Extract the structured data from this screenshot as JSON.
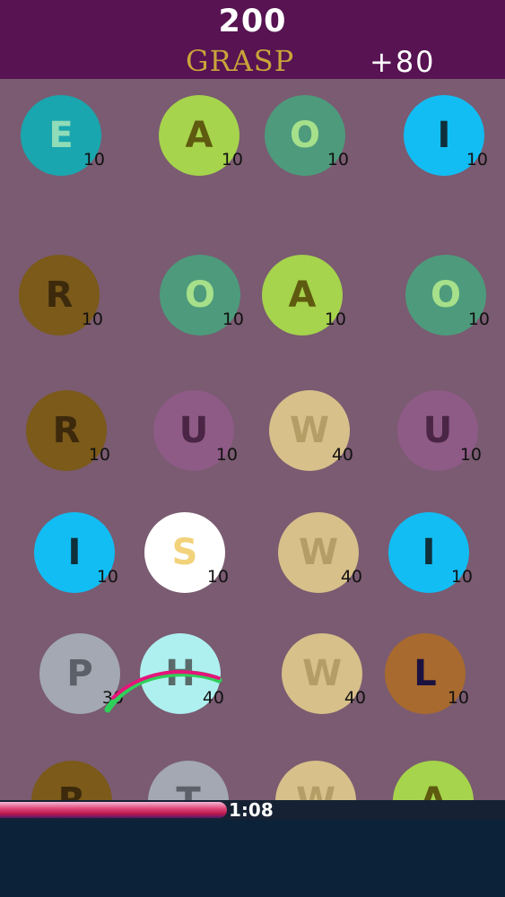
{
  "header": {
    "score": "200",
    "current_word": "GRASP",
    "word_bonus": "+80"
  },
  "board": {
    "tiles": [
      {
        "letter": "E",
        "points": "10",
        "color": "#1aa6ae",
        "text_color": "#8fdcb8"
      },
      {
        "letter": "A",
        "points": "10",
        "color": "#a6d44c",
        "text_color": "#5e5a10"
      },
      {
        "letter": "O",
        "points": "10",
        "color": "#4d9b7c",
        "text_color": "#a6e08a"
      },
      {
        "letter": "I",
        "points": "10",
        "color": "#12bdf3",
        "text_color": "#0f2f3a"
      },
      {
        "letter": "R",
        "points": "10",
        "color": "#7b5a1a",
        "text_color": "#3d2a0c"
      },
      {
        "letter": "O",
        "points": "10",
        "color": "#4d9b7c",
        "text_color": "#a6e08a"
      },
      {
        "letter": "A",
        "points": "10",
        "color": "#a6d44c",
        "text_color": "#5e5a10"
      },
      {
        "letter": "O",
        "points": "10",
        "color": "#4d9b7c",
        "text_color": "#a6e08a"
      },
      {
        "letter": "R",
        "points": "10",
        "color": "#7b5a1a",
        "text_color": "#3d2a0c"
      },
      {
        "letter": "U",
        "points": "10",
        "color": "#8e5a86",
        "text_color": "#4a2545"
      },
      {
        "letter": "W",
        "points": "40",
        "color": "#d7c08a",
        "text_color": "#b59e66"
      },
      {
        "letter": "U",
        "points": "10",
        "color": "#8e5a86",
        "text_color": "#4a2545"
      },
      {
        "letter": "I",
        "points": "10",
        "color": "#12bdf3",
        "text_color": "#0f2f3a"
      },
      {
        "letter": "S",
        "points": "10",
        "color": "#ffffff",
        "text_color": "#f2d27a"
      },
      {
        "letter": "W",
        "points": "40",
        "color": "#d7c08a",
        "text_color": "#b59e66"
      },
      {
        "letter": "I",
        "points": "10",
        "color": "#12bdf3",
        "text_color": "#0f2f3a"
      },
      {
        "letter": "P",
        "points": "30",
        "color": "#a3a8b2",
        "text_color": "#5c6068"
      },
      {
        "letter": "H",
        "points": "40",
        "color": "#aef0f0",
        "text_color": "#5a6a6a"
      },
      {
        "letter": "W",
        "points": "40",
        "color": "#d7c08a",
        "text_color": "#b59e66"
      },
      {
        "letter": "L",
        "points": "10",
        "color": "#a86a2e",
        "text_color": "#1c1240"
      },
      {
        "letter": "R",
        "points": "",
        "color": "#7b5a1a",
        "text_color": "#3d2a0c"
      },
      {
        "letter": "T",
        "points": "",
        "color": "#a3a8b2",
        "text_color": "#5c6068"
      },
      {
        "letter": "W",
        "points": "",
        "color": "#d7c08a",
        "text_color": "#b59e66"
      },
      {
        "letter": "A",
        "points": "",
        "color": "#a6d44c",
        "text_color": "#5e5a10"
      }
    ]
  },
  "timer": {
    "time_left": "1:08",
    "progress": 0.45
  }
}
